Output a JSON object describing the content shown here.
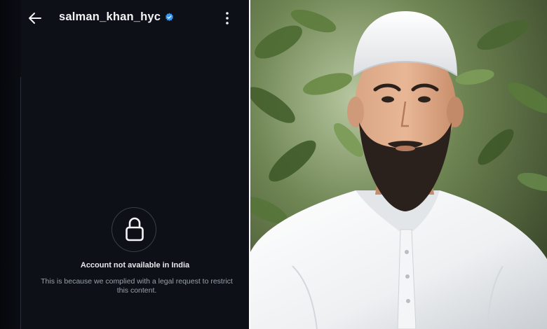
{
  "profile": {
    "username": "salman_khan_hyc",
    "verified": true
  },
  "restriction": {
    "title": "Account not available in India",
    "description": "This is because we complied with a legal request to restrict this content."
  },
  "icons": {
    "back": "arrow-left-icon",
    "verified": "verified-badge-icon",
    "more": "more-vertical-icon",
    "lock": "lock-icon"
  },
  "colors": {
    "app_background": "#0d1017",
    "verified_blue": "#3897f0",
    "title_text": "#e8e9ec",
    "secondary_text": "#9aa0a8"
  }
}
